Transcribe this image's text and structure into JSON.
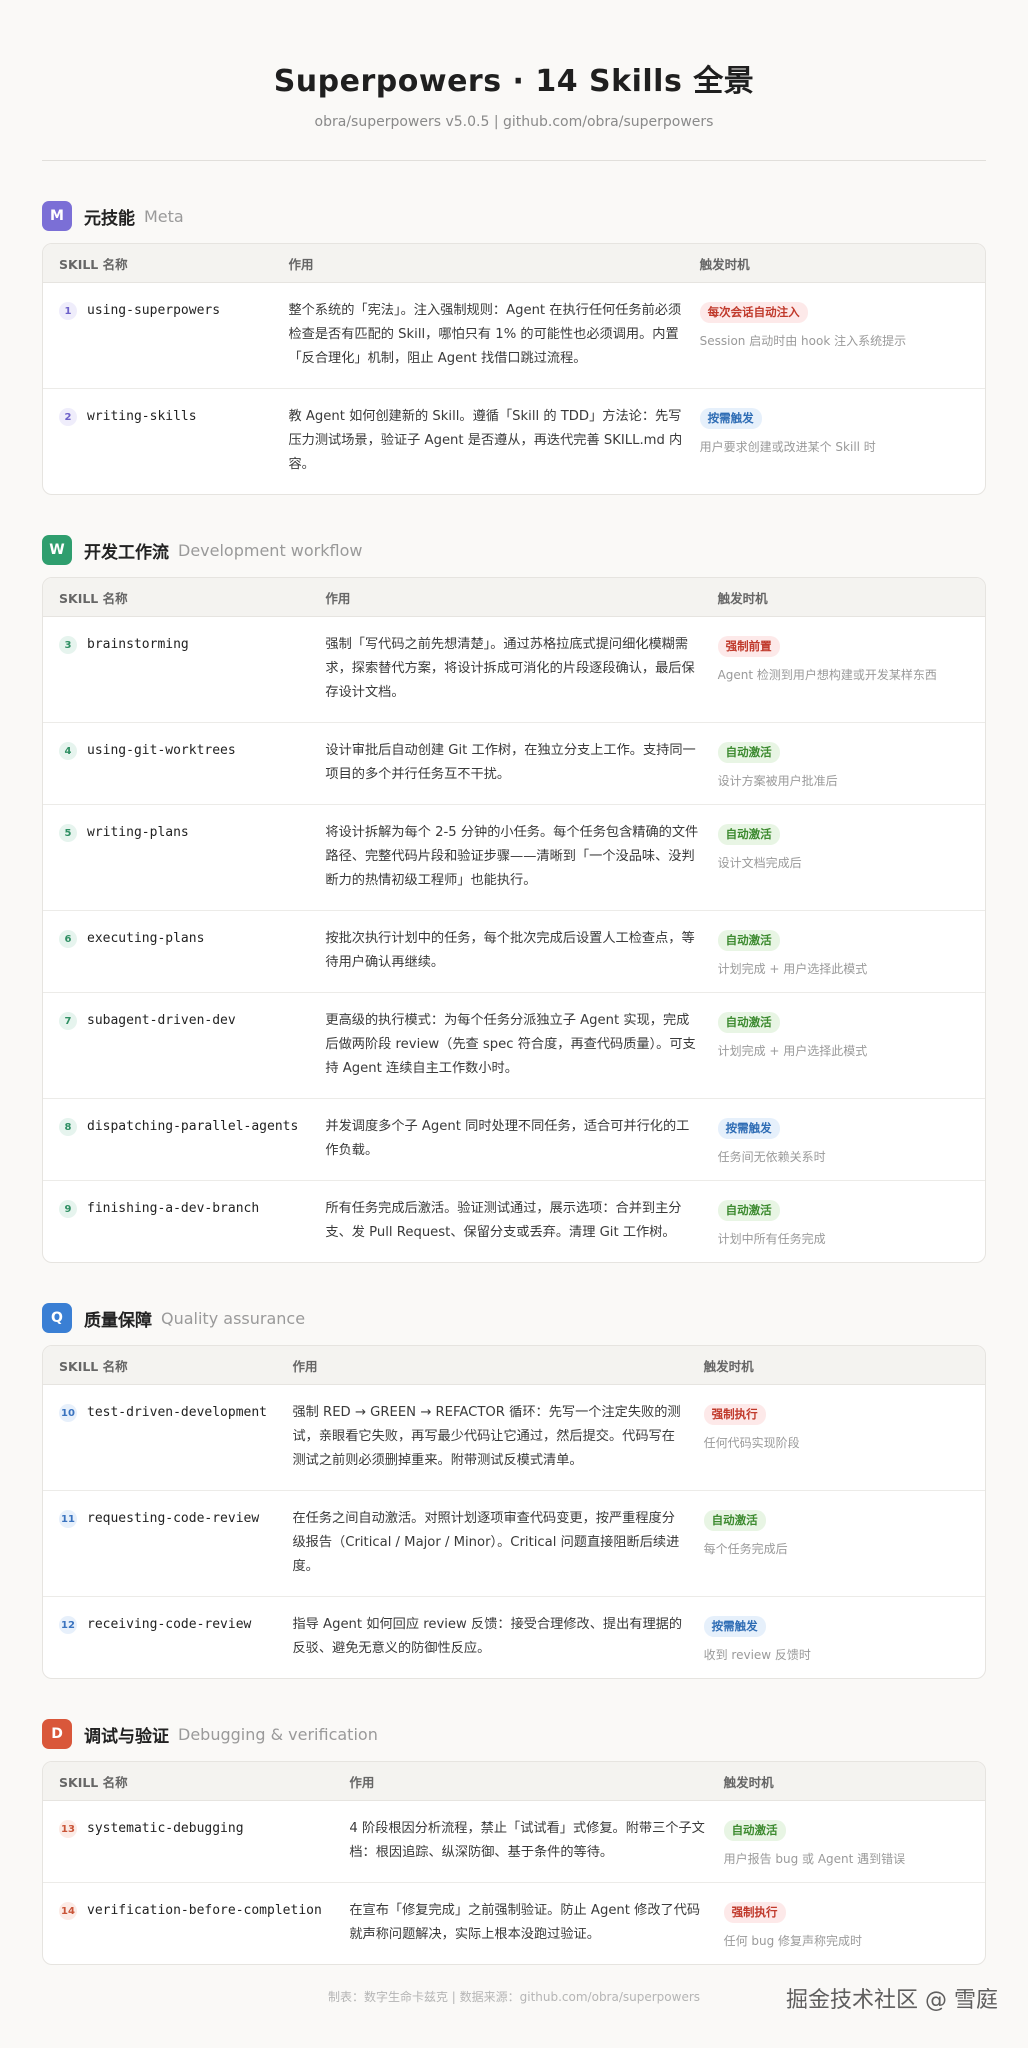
{
  "header": {
    "title": "Superpowers · 14 Skills 全景",
    "subtitle": "obra/superpowers v5.0.5  |  github.com/obra/superpowers"
  },
  "colors": {
    "meta": "#7b6fd6",
    "workflow": "#2f9e6e",
    "quality": "#3a7fd4",
    "debug": "#d9573a"
  },
  "table_headers": {
    "name": "SKILL 名称",
    "purpose": "作用",
    "trigger": "触发时机"
  },
  "sections": [
    {
      "letter": "M",
      "title": "元技能",
      "en": "Meta",
      "rows": [
        {
          "num": "1",
          "name": "using-superpowers",
          "desc": "整个系统的「宪法」。注入强制规则：Agent 在执行任何任务前必须检查是否有匹配的 Skill，哪怕只有 1% 的可能性也必须调用。内置「反合理化」机制，阻止 Agent 找借口跳过流程。",
          "badge": "每次会话自动注入",
          "trigger": "Session 启动时由 hook 注入系统提示"
        },
        {
          "num": "2",
          "name": "writing-skills",
          "desc": "教 Agent 如何创建新的 Skill。遵循「Skill 的 TDD」方法论：先写压力测试场景，验证子 Agent 是否遵从，再迭代完善 SKILL.md 内容。",
          "badge": "按需触发",
          "trigger": "用户要求创建或改进某个 Skill 时"
        }
      ]
    },
    {
      "letter": "W",
      "title": "开发工作流",
      "en": "Development workflow",
      "rows": [
        {
          "num": "3",
          "name": "brainstorming",
          "desc": "强制「写代码之前先想清楚」。通过苏格拉底式提问细化模糊需求，探索替代方案，将设计拆成可消化的片段逐段确认，最后保存设计文档。",
          "badge": "强制前置",
          "trigger": "Agent 检测到用户想构建或开发某样东西"
        },
        {
          "num": "4",
          "name": "using-git-worktrees",
          "desc": "设计审批后自动创建 Git 工作树，在独立分支上工作。支持同一项目的多个并行任务互不干扰。",
          "badge": "自动激活",
          "trigger": "设计方案被用户批准后"
        },
        {
          "num": "5",
          "name": "writing-plans",
          "desc": "将设计拆解为每个 2-5 分钟的小任务。每个任务包含精确的文件路径、完整代码片段和验证步骤——清晰到「一个没品味、没判断力的热情初级工程师」也能执行。",
          "badge": "自动激活",
          "trigger": "设计文档完成后"
        },
        {
          "num": "6",
          "name": "executing-plans",
          "desc": "按批次执行计划中的任务，每个批次完成后设置人工检查点，等待用户确认再继续。",
          "badge": "自动激活",
          "trigger": "计划完成 + 用户选择此模式"
        },
        {
          "num": "7",
          "name": "subagent-driven-dev",
          "desc": "更高级的执行模式：为每个任务分派独立子 Agent 实现，完成后做两阶段 review（先查 spec 符合度，再查代码质量）。可支持 Agent 连续自主工作数小时。",
          "badge": "自动激活",
          "trigger": "计划完成 + 用户选择此模式"
        },
        {
          "num": "8",
          "name": "dispatching-parallel-agents",
          "desc": "并发调度多个子 Agent 同时处理不同任务，适合可并行化的工作负载。",
          "badge": "按需触发",
          "trigger": "任务间无依赖关系时"
        },
        {
          "num": "9",
          "name": "finishing-a-dev-branch",
          "desc": "所有任务完成后激活。验证测试通过，展示选项：合并到主分支、发 Pull Request、保留分支或丢弃。清理 Git 工作树。",
          "badge": "自动激活",
          "trigger": "计划中所有任务完成"
        }
      ]
    },
    {
      "letter": "Q",
      "title": "质量保障",
      "en": "Quality assurance",
      "rows": [
        {
          "num": "10",
          "name": "test-driven-development",
          "desc": "强制 RED → GREEN → REFACTOR 循环：先写一个注定失败的测试，亲眼看它失败，再写最少代码让它通过，然后提交。代码写在测试之前则必须删掉重来。附带测试反模式清单。",
          "badge": "强制执行",
          "trigger": "任何代码实现阶段"
        },
        {
          "num": "11",
          "name": "requesting-code-review",
          "desc": "在任务之间自动激活。对照计划逐项审查代码变更，按严重程度分级报告（Critical / Major / Minor）。Critical 问题直接阻断后续进度。",
          "badge": "自动激活",
          "trigger": "每个任务完成后"
        },
        {
          "num": "12",
          "name": "receiving-code-review",
          "desc": "指导 Agent 如何回应 review 反馈：接受合理修改、提出有理据的反驳、避免无意义的防御性反应。",
          "badge": "按需触发",
          "trigger": "收到 review 反馈时"
        }
      ]
    },
    {
      "letter": "D",
      "title": "调试与验证",
      "en": "Debugging & verification",
      "rows": [
        {
          "num": "13",
          "name": "systematic-debugging",
          "desc": "4 阶段根因分析流程，禁止「试试看」式修复。附带三个子文档：根因追踪、纵深防御、基于条件的等待。",
          "badge": "自动激活",
          "trigger": "用户报告 bug 或 Agent 遇到错误"
        },
        {
          "num": "14",
          "name": "verification-before-completion",
          "desc": "在宣布「修复完成」之前强制验证。防止 Agent 修改了代码就声称问题解决，实际上根本没跑过验证。",
          "badge": "强制执行",
          "trigger": "任何 bug 修复声称完成时"
        }
      ]
    }
  ],
  "footer": "制表：数字生命卡兹克  |  数据来源：github.com/obra/superpowers",
  "watermark": "掘金技术社区 @ 雪庭"
}
